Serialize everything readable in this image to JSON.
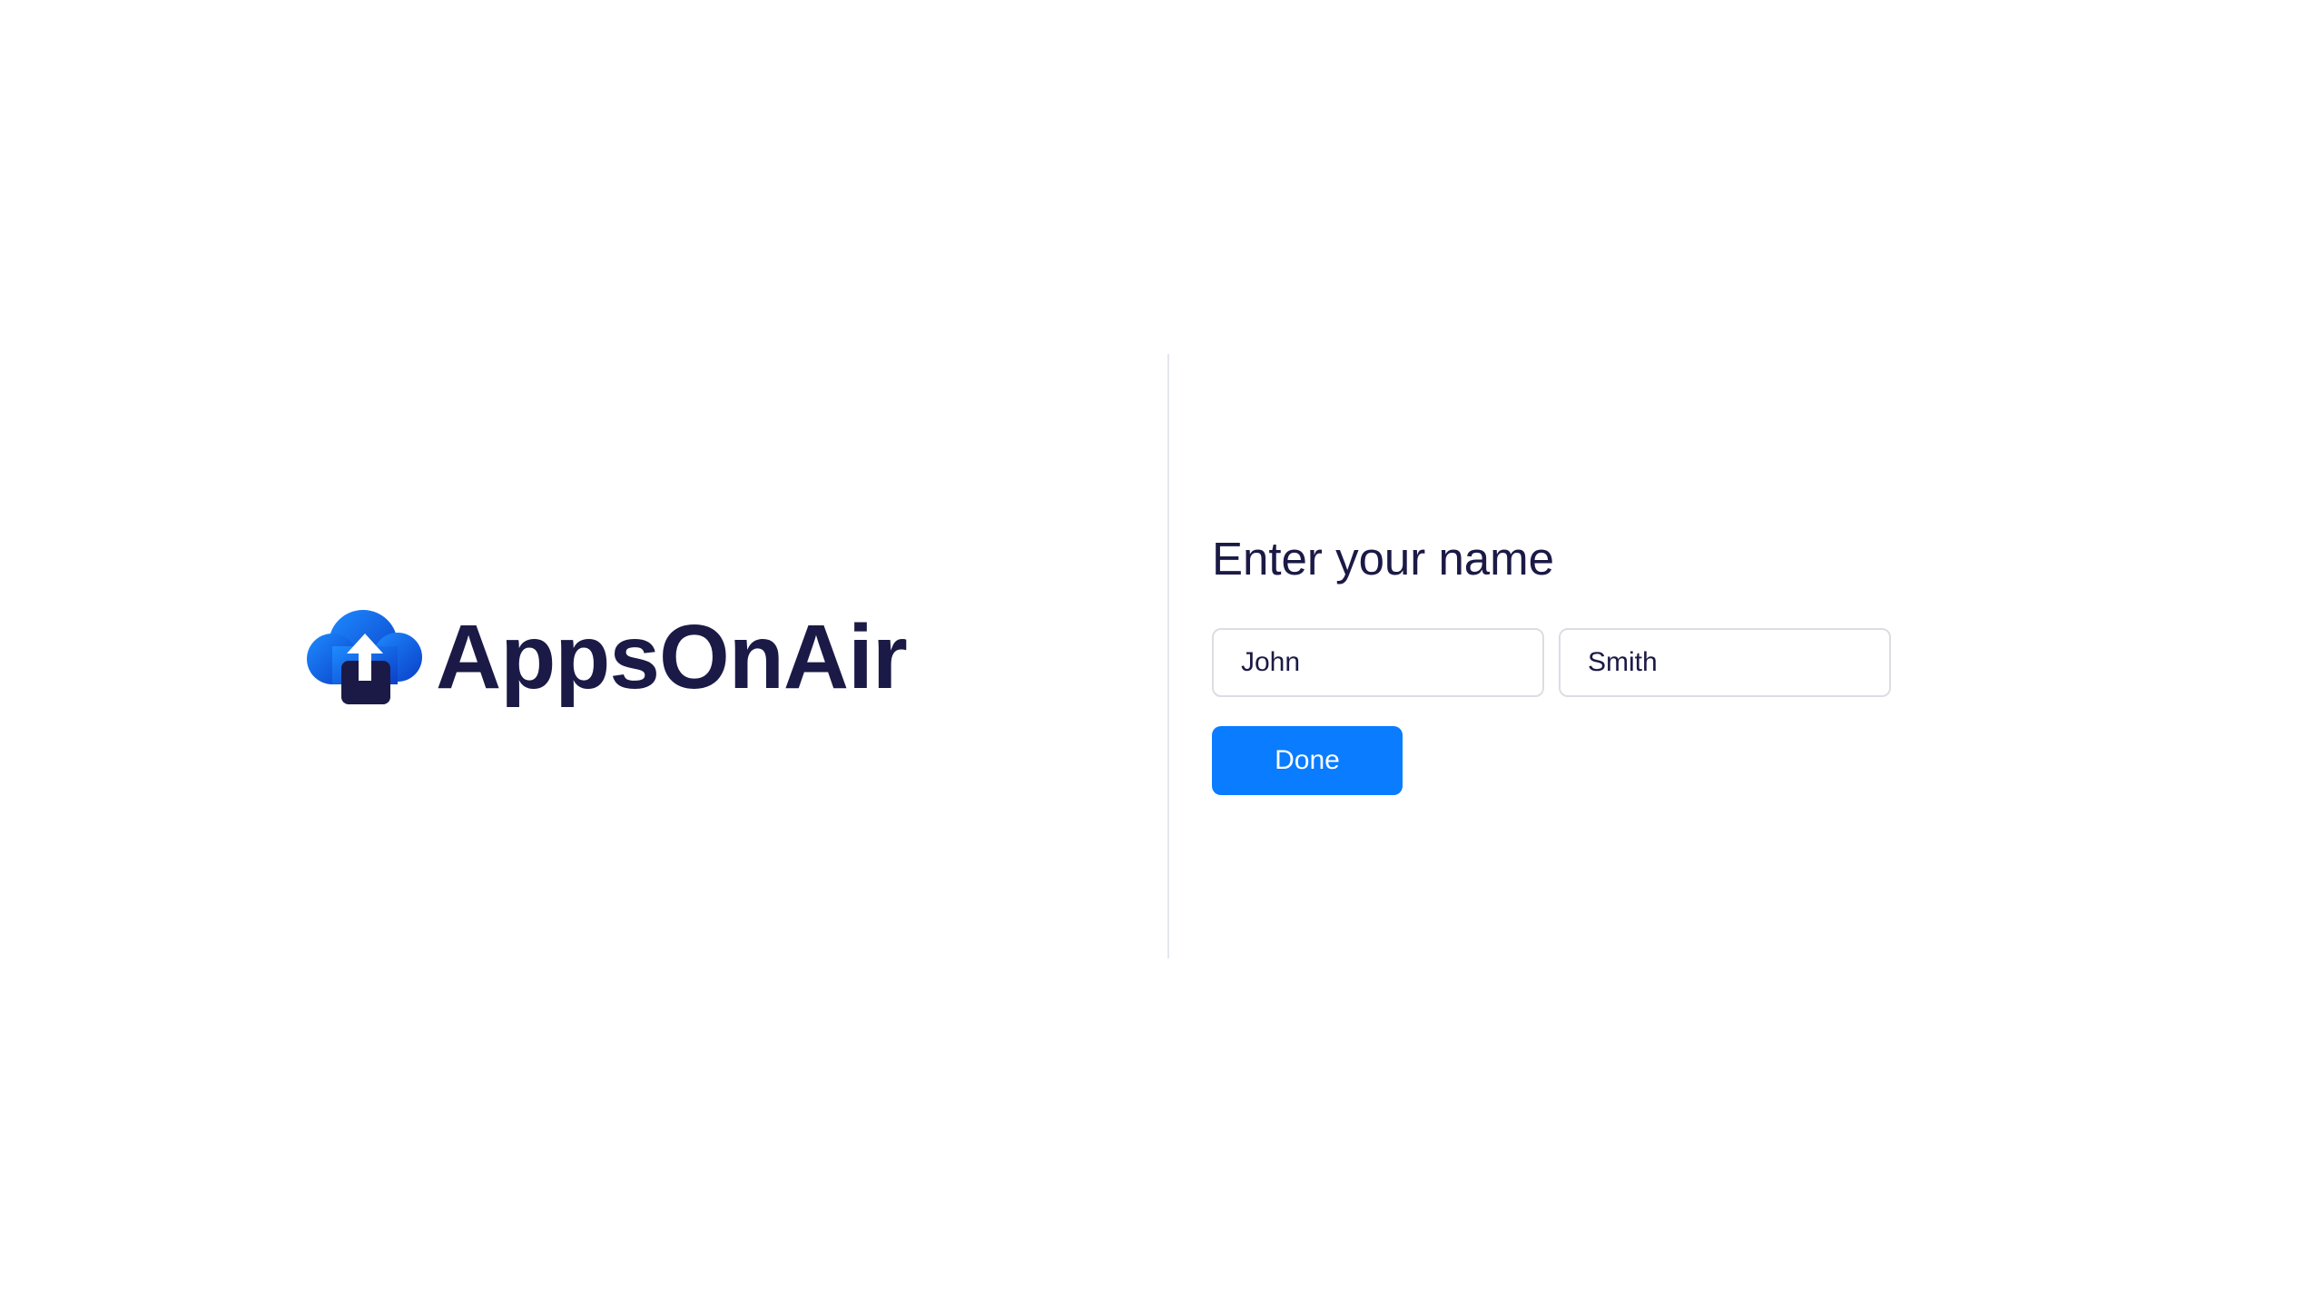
{
  "brand": {
    "name": "AppsOnAir",
    "logo_icon": "cloud-upload-icon",
    "colors": {
      "text": "#1b1a46",
      "cloud_light": "#1e8bff",
      "cloud_dark": "#0a3fc7",
      "box": "#1b1a46"
    }
  },
  "form": {
    "title": "Enter your name",
    "first_name": {
      "value": "John",
      "placeholder": ""
    },
    "last_name": {
      "value": "Smith",
      "placeholder": ""
    },
    "submit_label": "Done",
    "accent_color": "#0a7cff"
  }
}
